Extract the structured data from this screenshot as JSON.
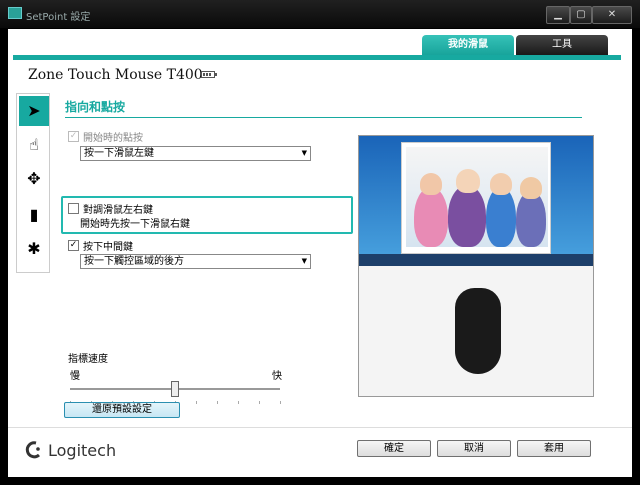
{
  "window": {
    "title": "SetPoint 設定"
  },
  "tabs": [
    {
      "label": "我的滑鼠",
      "active": true
    },
    {
      "label": "工具",
      "active": false
    }
  ],
  "product": {
    "name": "Zone Touch Mouse T400"
  },
  "side_tabs": [
    {
      "icon": "pointer-click-icon",
      "active": true
    },
    {
      "icon": "hand-touch-icon",
      "active": false
    },
    {
      "icon": "move-arrows-icon",
      "active": false
    },
    {
      "icon": "battery-icon",
      "active": false
    },
    {
      "icon": "logitech-settings-icon",
      "active": false
    }
  ],
  "section": {
    "title": "指向和點按",
    "startup_click_label": "開始時的點按",
    "startup_click_checked": true,
    "startup_click_value": "按一下滑鼠左鍵",
    "swap_label": "對調滑鼠左右鍵",
    "swap_checked": false,
    "swap_desc": "開始時先按一下滑鼠右鍵",
    "middle_label": "按下中間鍵",
    "middle_checked": true,
    "middle_value": "按一下觸控區域的後方",
    "speed_label": "指標速度",
    "slow_label": "慢",
    "fast_label": "快",
    "speed_value": 0.5,
    "restore_label": "還原預設設定"
  },
  "brand": {
    "name": "Logitech"
  },
  "dialog_buttons": {
    "ok": "確定",
    "cancel": "取消",
    "apply": "套用"
  },
  "colors": {
    "accent": "#17a9a0"
  }
}
